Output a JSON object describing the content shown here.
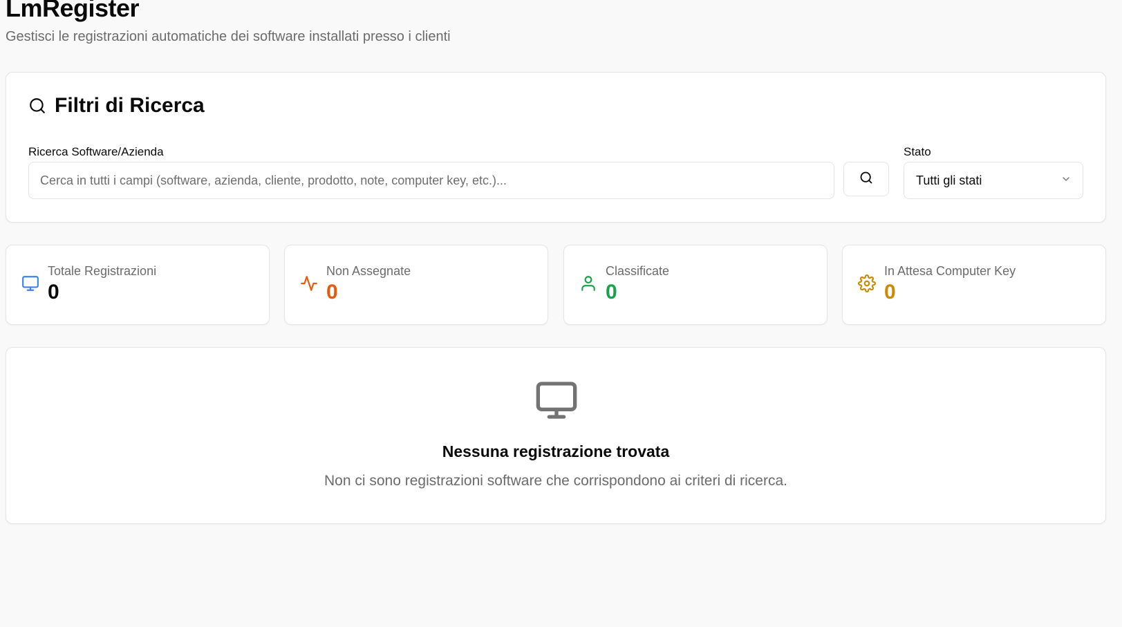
{
  "header": {
    "title": "LmRegister",
    "subtitle": "Gestisci le registrazioni automatiche dei software installati presso i clienti"
  },
  "filters": {
    "title": "Filtri di Ricerca",
    "title_icon": "search-icon",
    "search": {
      "label": "Ricerca Software/Azienda",
      "placeholder": "Cerca in tutti i campi (software, azienda, cliente, prodotto, note, computer key, etc.)...",
      "value": "",
      "button_icon": "search-icon"
    },
    "status": {
      "label": "Stato",
      "selected": "Tutti gli stati",
      "icon": "chevron-down-icon"
    }
  },
  "stats": [
    {
      "label": "Totale Registrazioni",
      "value": "0",
      "icon": "monitor-icon",
      "color": "#3b82f6",
      "value_color": "#0a0a0a"
    },
    {
      "label": "Non Assegnate",
      "value": "0",
      "icon": "activity-icon",
      "color": "#ea580c",
      "value_color": "#ea580c"
    },
    {
      "label": "Classificate",
      "value": "0",
      "icon": "user-icon",
      "color": "#16a34a",
      "value_color": "#16a34a"
    },
    {
      "label": "In Attesa Computer Key",
      "value": "0",
      "icon": "gear-icon",
      "color": "#ca8a04",
      "value_color": "#ca8a04"
    }
  ],
  "empty_state": {
    "icon": "monitor-icon",
    "icon_color": "#737373",
    "title": "Nessuna registrazione trovata",
    "message": "Non ci sono registrazioni software che corrispondono ai criteri di ricerca."
  }
}
